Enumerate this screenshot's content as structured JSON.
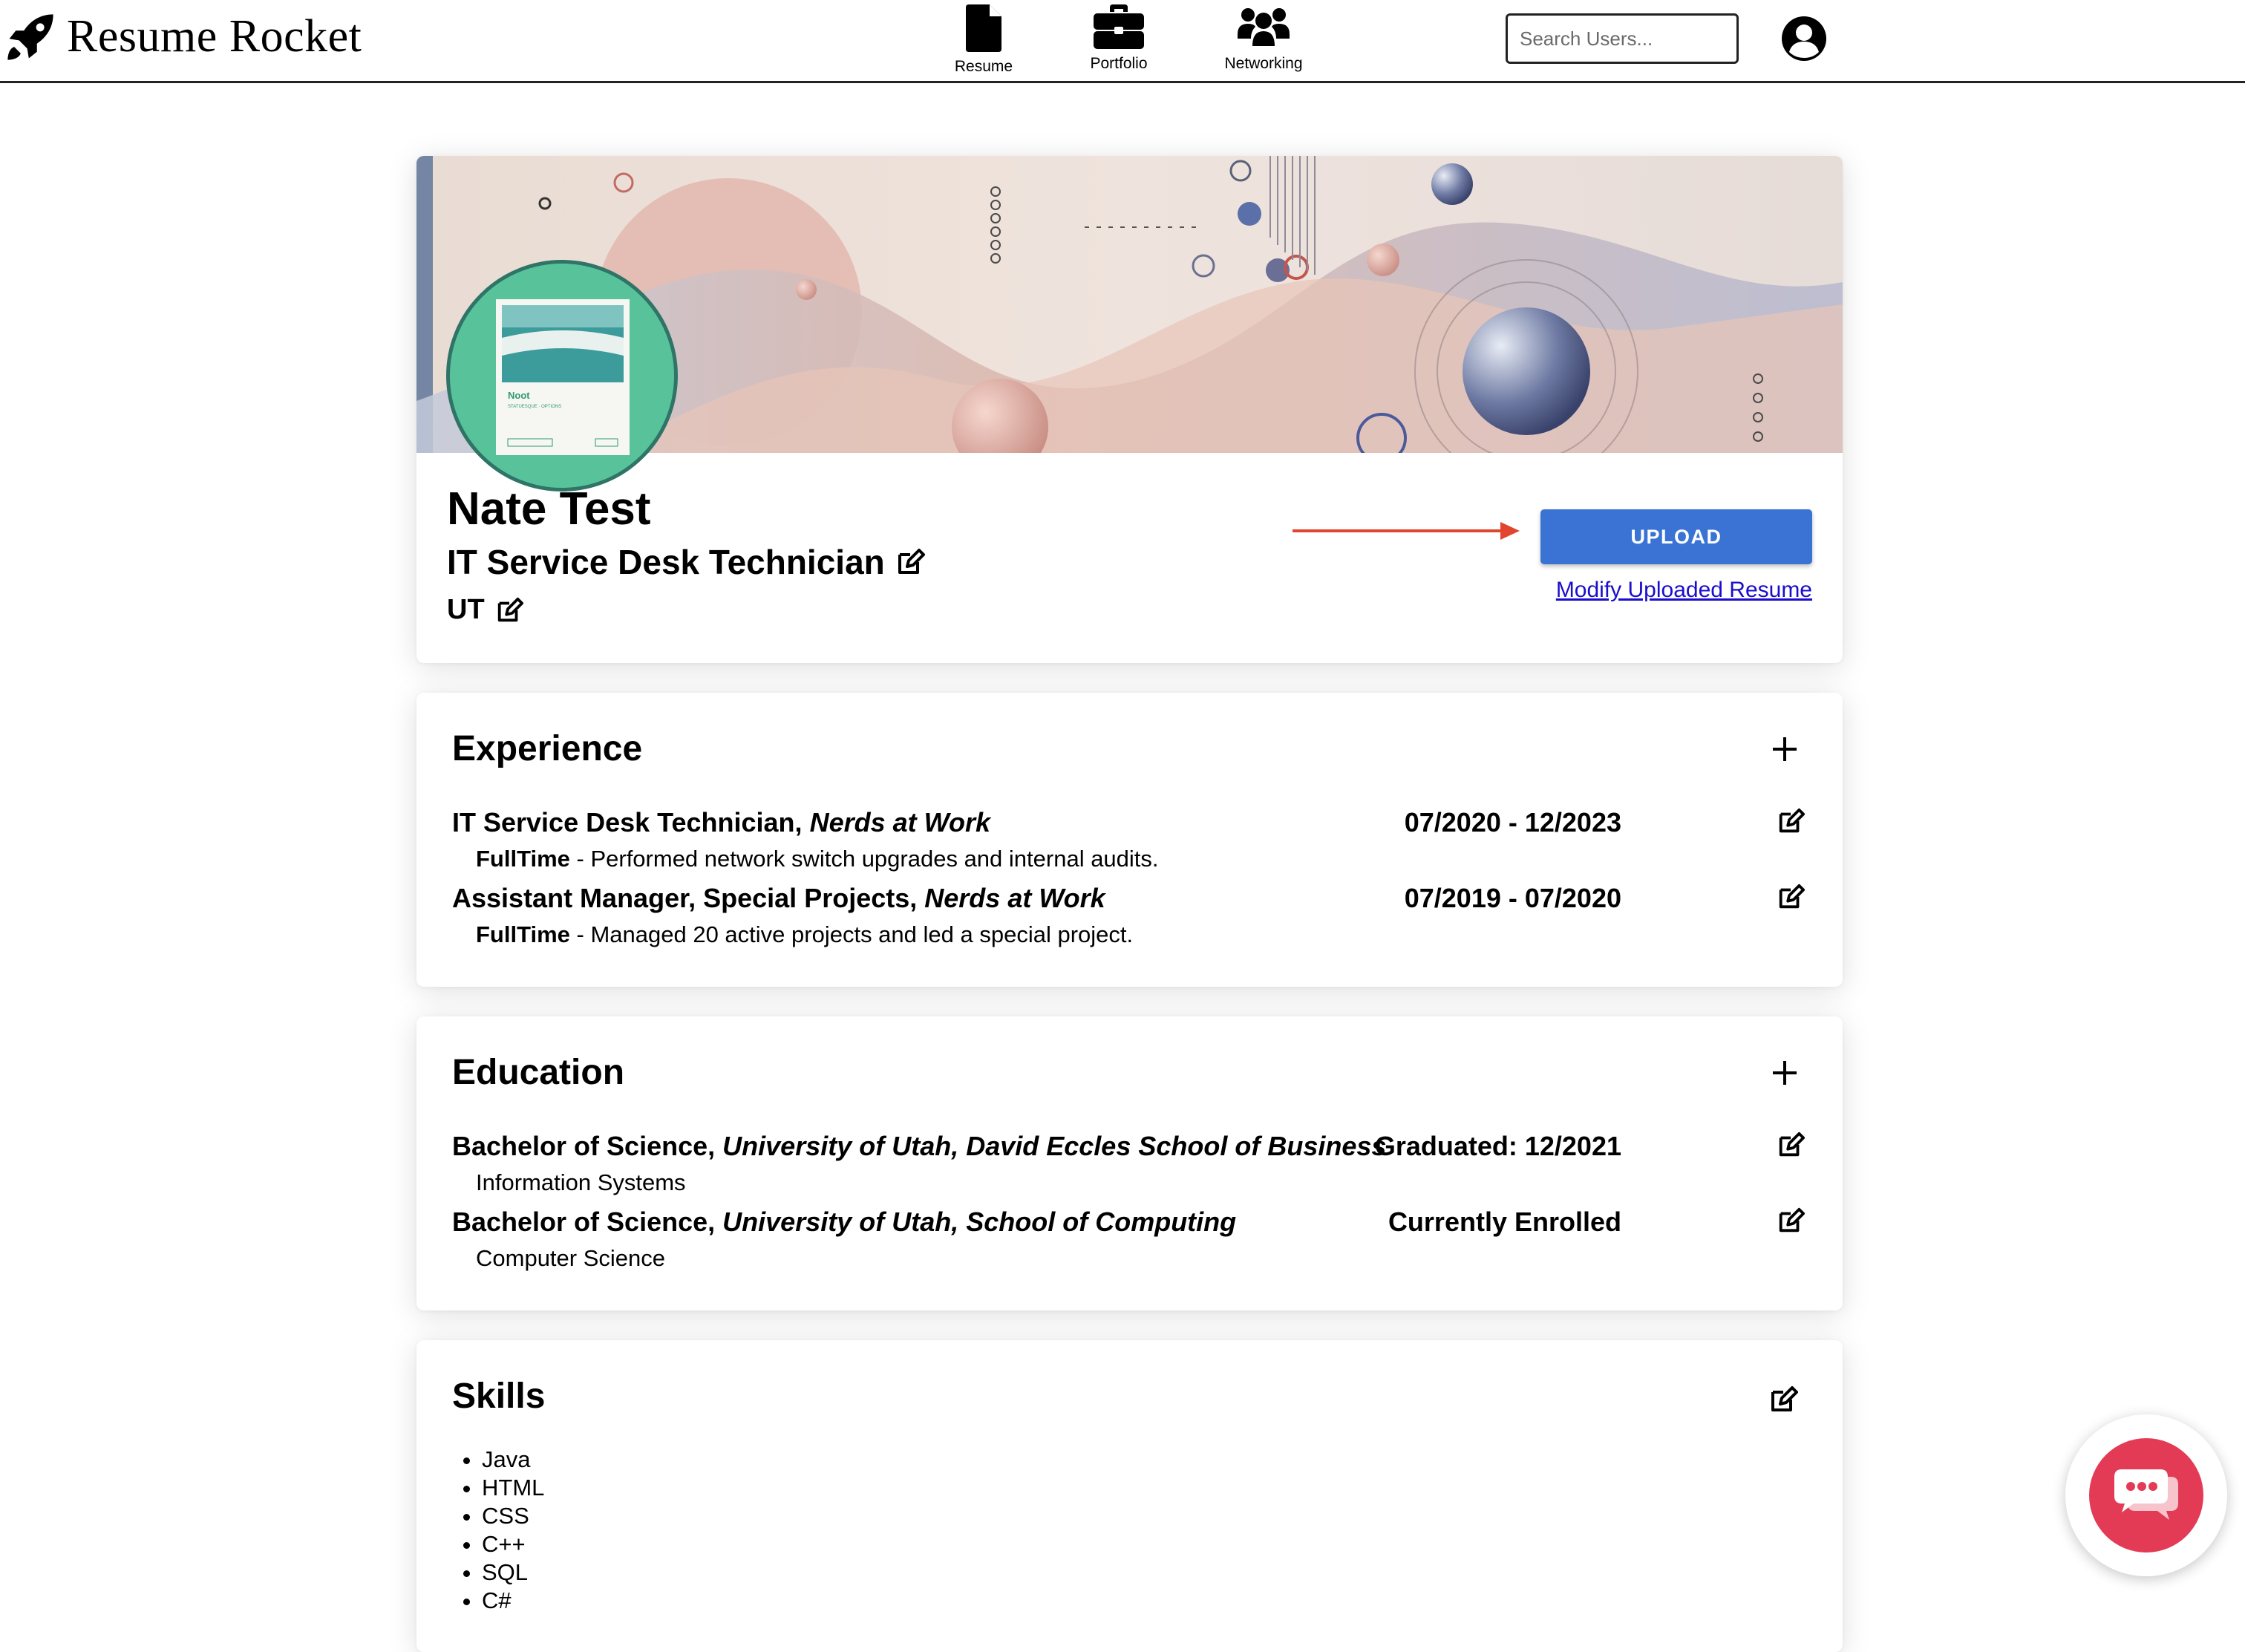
{
  "brand": {
    "name": "Resume Rocket"
  },
  "nav": {
    "resume": "Resume",
    "portfolio": "Portfolio",
    "networking": "Networking"
  },
  "search": {
    "placeholder": "Search Users..."
  },
  "profile": {
    "name": "Nate Test",
    "title": "IT Service Desk Technician",
    "location": "UT",
    "upload_label": "UPLOAD",
    "modify_link": "Modify Uploaded Resume",
    "avatar_text": {
      "line1": "Noot",
      "line2": "STATUESQUE · OPTIONS"
    }
  },
  "experience": {
    "heading": "Experience",
    "items": [
      {
        "role": "IT Service Desk Technician,",
        "company": "Nerds at Work",
        "dates": "07/2020 - 12/2023",
        "type": "FullTime",
        "description": " - Performed network switch upgrades and internal audits."
      },
      {
        "role": "Assistant Manager, Special Projects,",
        "company": "Nerds at Work",
        "dates": "07/2019 - 07/2020",
        "type": "FullTime",
        "description": " - Managed 20 active projects and led a special project."
      }
    ]
  },
  "education": {
    "heading": "Education",
    "items": [
      {
        "degree": "Bachelor of Science,",
        "school": "University of Utah, David Eccles School of Business",
        "status": "Graduated: 12/2021",
        "major": "Information Systems"
      },
      {
        "degree": "Bachelor of Science,",
        "school": "University of Utah, School of Computing",
        "status": "Currently Enrolled",
        "major": "Computer Science"
      }
    ]
  },
  "skills": {
    "heading": "Skills",
    "items": [
      "Java",
      "HTML",
      "CSS",
      "C++",
      "SQL",
      "C#"
    ]
  },
  "colors": {
    "primary_button": "#3a73d4",
    "link": "#1a0dcc",
    "arrow": "#e2452f",
    "chat": "#e33b55",
    "avatar_bg": "#58c39b"
  }
}
